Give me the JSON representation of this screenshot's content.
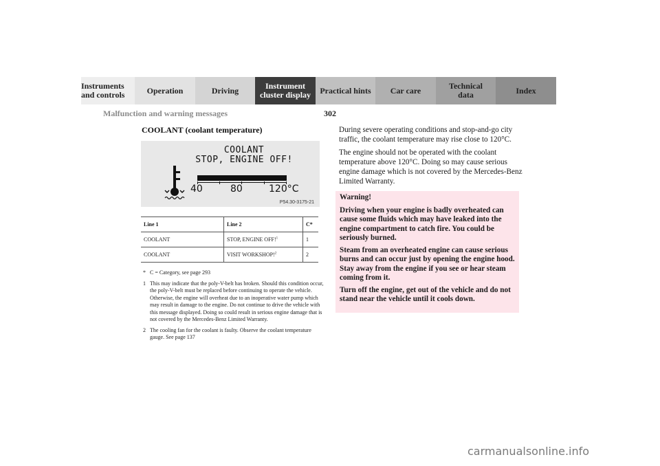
{
  "nav": {
    "tabs": [
      {
        "label": "Instruments and controls",
        "active": false
      },
      {
        "label": "Operation",
        "active": false
      },
      {
        "label": "Driving",
        "active": false
      },
      {
        "label": "Instrument cluster display",
        "active": true
      },
      {
        "label": "Practical hints",
        "active": false
      },
      {
        "label": "Car care",
        "active": false
      },
      {
        "label": "Technical data",
        "active": false
      },
      {
        "label": "Index",
        "active": false
      }
    ]
  },
  "header": {
    "section_title": "Malfunction and warning messages",
    "page_number": "302"
  },
  "heading": "COOLANT (coolant temperature)",
  "display": {
    "line1": "COOLANT",
    "line2": "STOP, ENGINE OFF!",
    "scale_40": "40",
    "scale_80": "80",
    "scale_120": "120°C",
    "gauge_fill_percent": 100,
    "image_ref": "P54.30-3175-21",
    "icon": "coolant-thermometer-icon"
  },
  "table": {
    "headers": [
      "Line 1",
      "Line 2",
      "C*"
    ],
    "rows": [
      {
        "line1": "COOLANT",
        "line2": "STOP, ENGINE OFF!",
        "sup": "1",
        "c": "1"
      },
      {
        "line1": "COOLANT",
        "line2": "VISIT WORKSHOP!",
        "sup": "2",
        "c": "2"
      }
    ]
  },
  "notes": [
    {
      "marker": "*",
      "text": "C = Category, see page 293"
    },
    {
      "marker": "1",
      "text": "This may indicate that the poly-V-belt has broken. Should this condition occur, the poly-V-belt must be replaced before continuing to operate the vehicle. Otherwise, the engine will overheat due to an inoperative water pump which may result in damage to the engine. Do not continue to drive the vehicle with this message displayed. Doing so could result in serious engine damage that is not covered by the Mercedes-Benz Limited Warranty."
    },
    {
      "marker": "2",
      "text": "The cooling fan for the coolant is faulty. Observe the coolant temperature gauge. See page 137"
    }
  ],
  "body": {
    "p1": "During severe operating conditions and stop-and-go city traffic, the coolant temperature may rise close to 120°C.",
    "p2": "The engine should not be operated with the coolant temperature above 120°C. Doing so may cause serious engine damage which is not covered by the Mercedes-Benz Limited Warranty."
  },
  "warning": {
    "title": "Warning!",
    "p1": "Driving when your engine is badly overheated can cause some fluids which may have leaked into the engine compartment to catch fire. You could be seriously burned.",
    "p2": "Steam from an overheated engine can cause serious burns and can occur just by opening the engine hood. Stay away from the engine if you see or hear steam coming from it.",
    "p3": "Turn off the engine, get out of the vehicle and do not stand near the vehicle until it cools down."
  },
  "watermark": "carmanualsonline.info"
}
